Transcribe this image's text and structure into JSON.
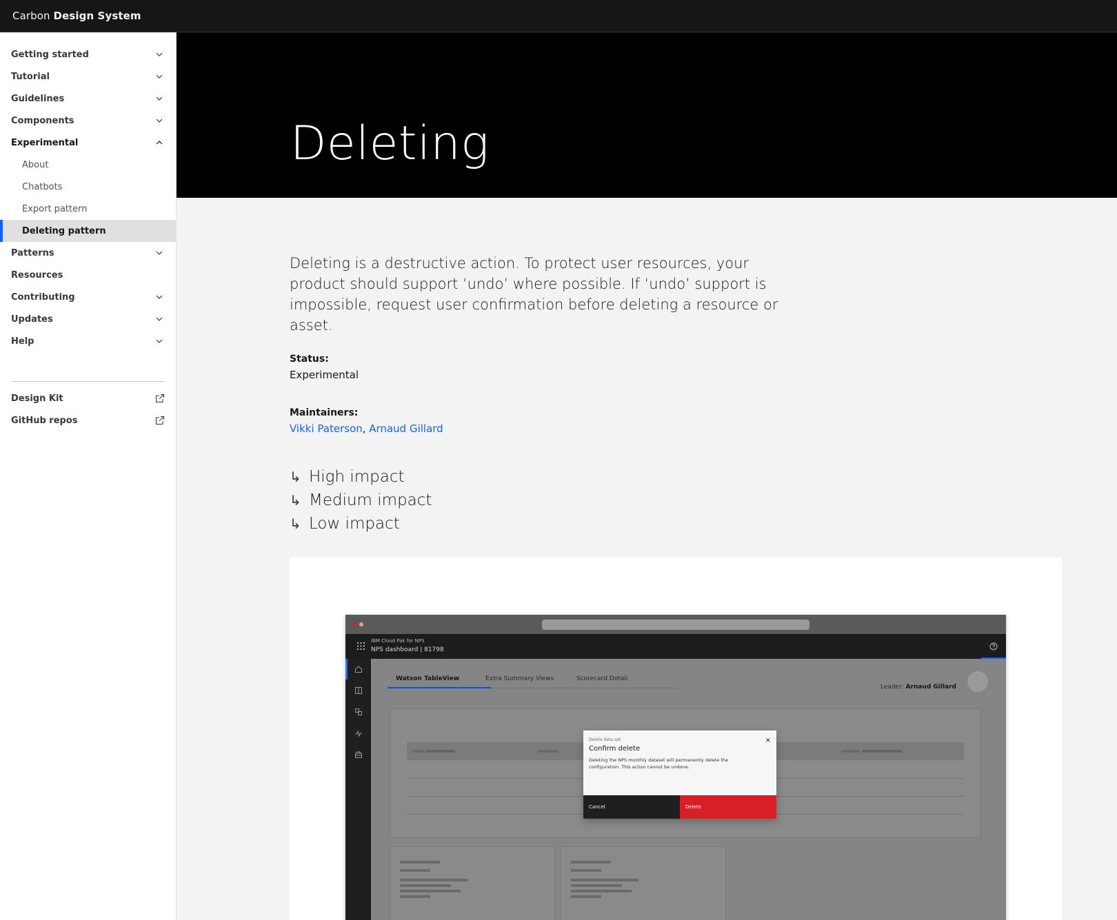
{
  "header": {
    "brand_light": "Carbon",
    "brand_bold": "Design System"
  },
  "sidebar": {
    "items": [
      {
        "label": "Getting started",
        "icon": "chevron-down-icon"
      },
      {
        "label": "Tutorial",
        "icon": "chevron-down-icon"
      },
      {
        "label": "Guidelines",
        "icon": "chevron-down-icon"
      },
      {
        "label": "Components",
        "icon": "chevron-down-icon"
      },
      {
        "label": "Experimental",
        "icon": "chevron-up-icon"
      },
      {
        "label": "Patterns",
        "icon": "chevron-down-icon"
      },
      {
        "label": "Resources"
      },
      {
        "label": "Contributing",
        "icon": "chevron-down-icon"
      },
      {
        "label": "Updates",
        "icon": "chevron-down-icon"
      },
      {
        "label": "Help",
        "icon": "chevron-down-icon"
      }
    ],
    "experimental_sub": [
      {
        "label": "About"
      },
      {
        "label": "Chatbots"
      },
      {
        "label": "Export pattern"
      },
      {
        "label": "Deleting pattern",
        "active": true
      }
    ],
    "external": [
      {
        "label": "Design Kit",
        "icon": "launch-icon"
      },
      {
        "label": "GitHub repos",
        "icon": "launch-icon"
      }
    ]
  },
  "hero": {
    "title": "Deleting"
  },
  "content": {
    "lead": "Deleting is a destructive action. To protect user resources, your product should support ‘undo’ where possible. If ‘undo’ support is impossible, request user confirmation before deleting a resource or asset.",
    "status_label": "Status:",
    "status_value": "Experimental",
    "maintainers_label": "Maintainers:",
    "maintainers": [
      "Vikki Paterson",
      "Arnaud Gillard"
    ],
    "maintainers_separator": ", ",
    "anchor_arrow": "↳",
    "anchors": [
      "High impact",
      "Medium impact",
      "Low impact"
    ]
  },
  "mockup": {
    "header_line1": "IBM Cloud Pak for NPS",
    "header_line2": "NPS dashboard | 81798",
    "tabs": [
      "Watson TableView",
      "Extra Summary Views",
      "Scorecard Detail"
    ],
    "leader_label": "Leader:",
    "leader_name": "Arnaud Gillard",
    "modal": {
      "label": "Delete data set",
      "title": "Confirm delete",
      "body": "Deleting the NPS monthly dataset will permanently delete the configuration. This action cannot be undone.",
      "close": "×",
      "cancel": "Cancel",
      "delete": "Delete"
    }
  },
  "colors": {
    "accent": "#0f62fe",
    "danger": "#da1e28",
    "header_bg": "#161616",
    "hero_bg": "#000000",
    "page_bg": "#f3f3f3"
  }
}
